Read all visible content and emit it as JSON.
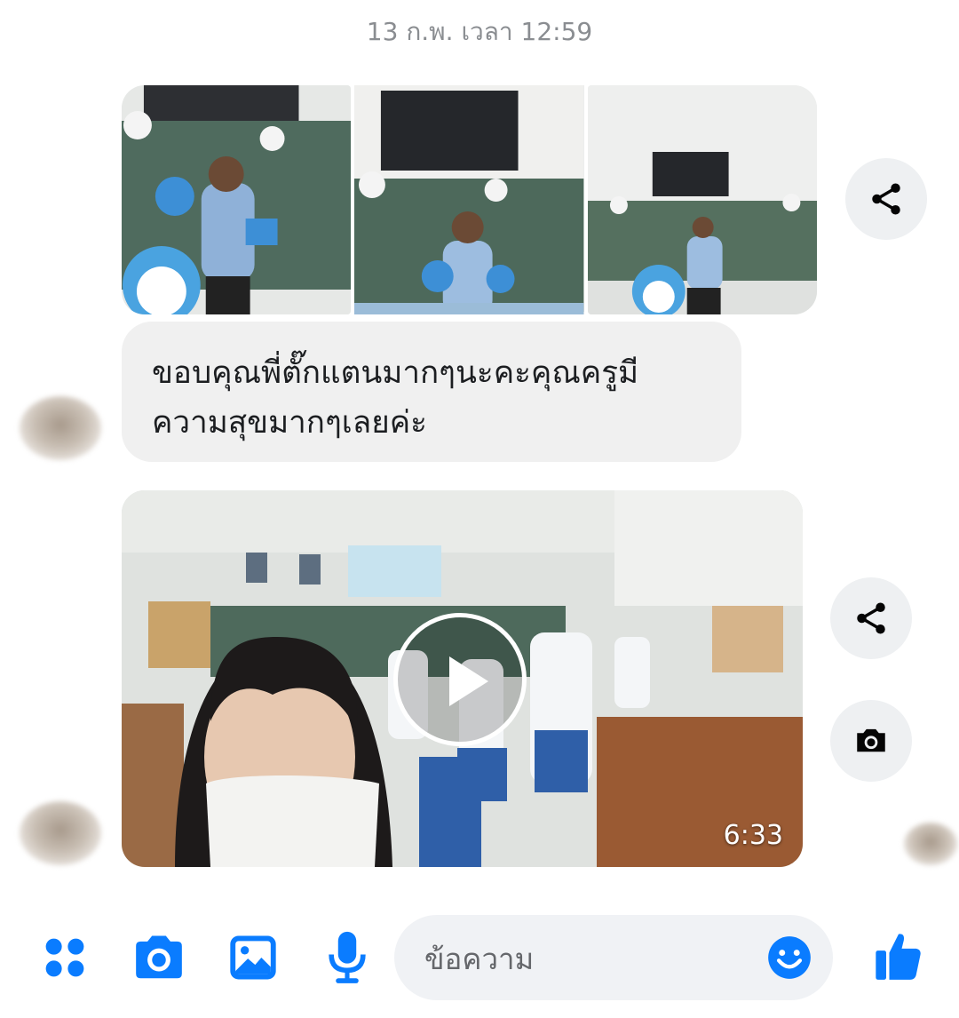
{
  "chat": {
    "timestamp": "13 ก.พ. เวลา 12:59",
    "message_lines": [
      "ขอบคุณพี่ตั๊กแตนมากๆนะคะคุณครูมี",
      "ความสุขมากๆเลยค่ะ"
    ],
    "video": {
      "duration": "6:33"
    }
  },
  "composer": {
    "placeholder": "ข้อความ"
  },
  "icons": {
    "apps": "apps-icon",
    "camera": "camera-icon",
    "gallery": "gallery-icon",
    "mic": "microphone-icon",
    "emoji": "emoji-icon",
    "like": "thumbs-up-icon",
    "share": "share-icon"
  },
  "colors": {
    "accent": "#0a7cff",
    "bubble": "#f0f0f0",
    "timestamp": "#8a8d91"
  }
}
